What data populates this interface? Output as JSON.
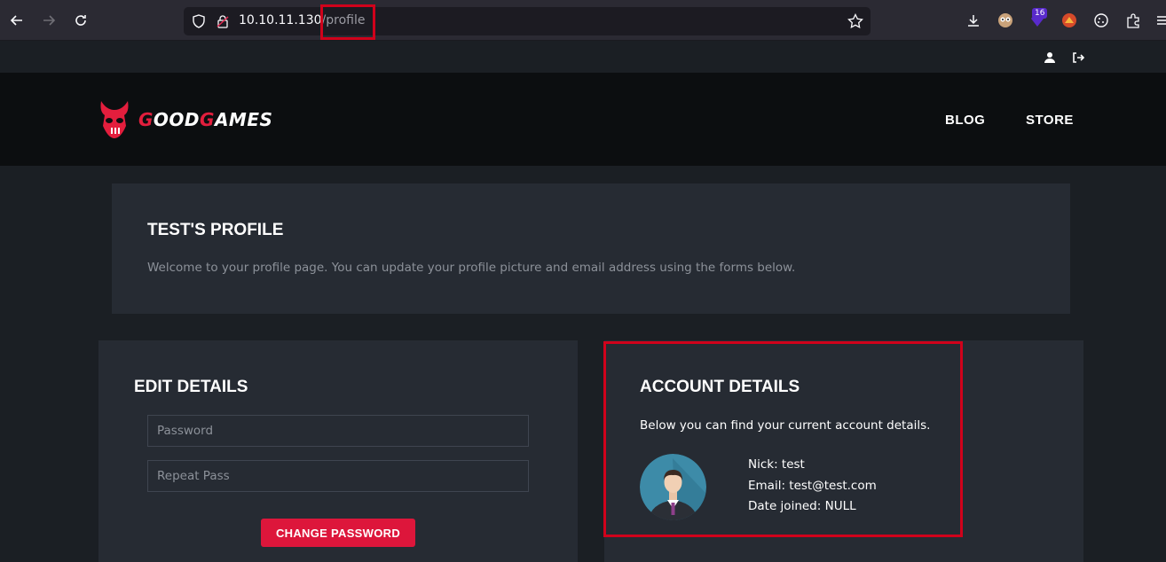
{
  "browser": {
    "url_host": "10.10.11.130",
    "url_path": "/profile",
    "extension_badge": "16"
  },
  "header": {
    "logo_part1": "G",
    "logo_part2": "OOD",
    "logo_part3": "G",
    "logo_part4": "AMES",
    "nav": [
      "BLOG",
      "STORE"
    ]
  },
  "profile": {
    "title": "TEST'S PROFILE",
    "description": "Welcome to your profile page. You can update your profile picture and email address using the forms below."
  },
  "edit": {
    "title": "EDIT DETAILS",
    "password_placeholder": "Password",
    "repeat_placeholder": "Repeat Pass",
    "button": "CHANGE PASSWORD"
  },
  "account": {
    "title": "ACCOUNT DETAILS",
    "description": "Below you can find your current account details.",
    "nick": "Nick: test",
    "email": "Email: test@test.com",
    "joined": "Date joined: NULL"
  },
  "colors": {
    "accent": "#dd163b",
    "card": "#262b33",
    "highlight": "#d0021b"
  }
}
